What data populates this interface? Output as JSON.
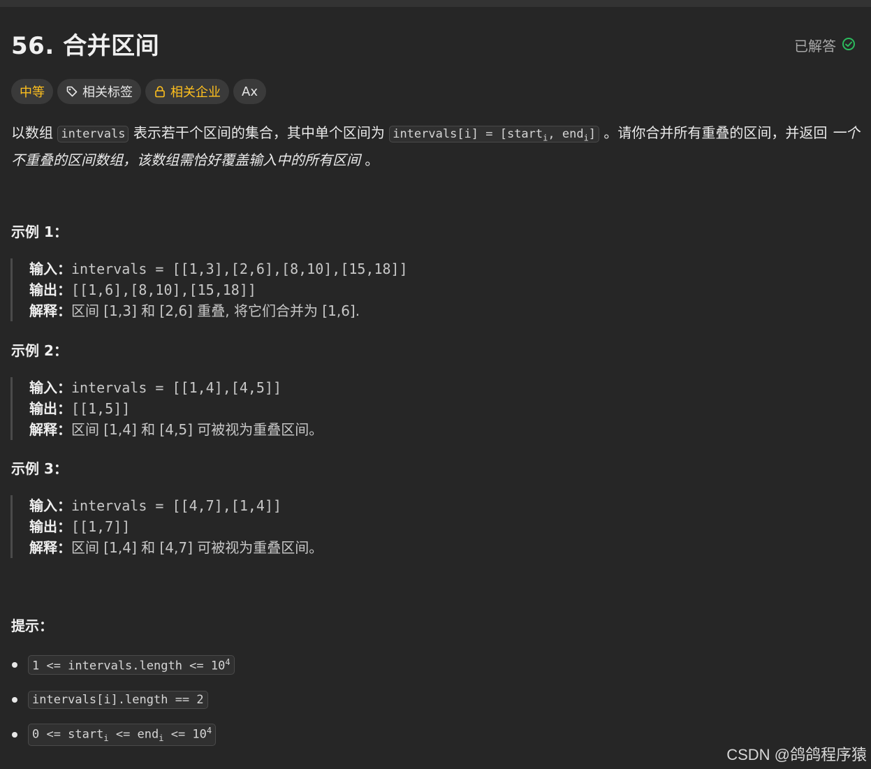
{
  "problem": {
    "title": "56. 合并区间",
    "status_label": "已解答"
  },
  "tags": {
    "difficulty": "中等",
    "related_tags": "相关标签",
    "related_companies": "相关企业",
    "font_toggle": "Ax"
  },
  "description": {
    "p1": "以数组 ",
    "code1": "intervals",
    "p2": " 表示若干个区间的集合，其中单个区间为 ",
    "code2_a": "intervals[i] = [start",
    "code2_sub1": "i",
    "code2_b": ", end",
    "code2_sub2": "i",
    "code2_c": "]",
    "p3": " 。请你合并所有重叠的区间，并返回 ",
    "emphasis": "一个不重叠的区间数组，该数组需恰好覆盖输入中的所有区间",
    "p4": " 。"
  },
  "examples": [
    {
      "title": "示例 1：",
      "input_label": "输入：",
      "input": "intervals = [[1,3],[2,6],[8,10],[15,18]]",
      "output_label": "输出：",
      "output": "[[1,6],[8,10],[15,18]]",
      "explain_label": "解释：",
      "explain": "区间 [1,3] 和 [2,6] 重叠, 将它们合并为 [1,6]."
    },
    {
      "title": "示例 2：",
      "input_label": "输入：",
      "input": "intervals = [[1,4],[4,5]]",
      "output_label": "输出：",
      "output": "[[1,5]]",
      "explain_label": "解释：",
      "explain": "区间 [1,4] 和 [4,5] 可被视为重叠区间。"
    },
    {
      "title": "示例 3：",
      "input_label": "输入：",
      "input": "intervals = [[4,7],[1,4]]",
      "output_label": "输出：",
      "output": "[[1,7]]",
      "explain_label": "解释：",
      "explain": "区间 [1,4] 和 [4,7] 可被视为重叠区间。"
    }
  ],
  "hints": {
    "title": "提示：",
    "c1_a": "1 <= intervals.length <= 10",
    "c1_sup": "4",
    "c2": "intervals[i].length == 2",
    "c3_a": "0 <= start",
    "c3_sub1": "i",
    "c3_b": " <= end",
    "c3_sub2": "i",
    "c3_c": " <= 10",
    "c3_sup": "4"
  },
  "watermark": "CSDN @鸽鸽程序猿",
  "colors": {
    "background": "#262626",
    "medium": "#ffc01e",
    "solved_check": "#2cbb5d"
  },
  "icons": {
    "status": "check-circle-icon",
    "tag": "tag-icon",
    "lock": "lock-icon"
  }
}
